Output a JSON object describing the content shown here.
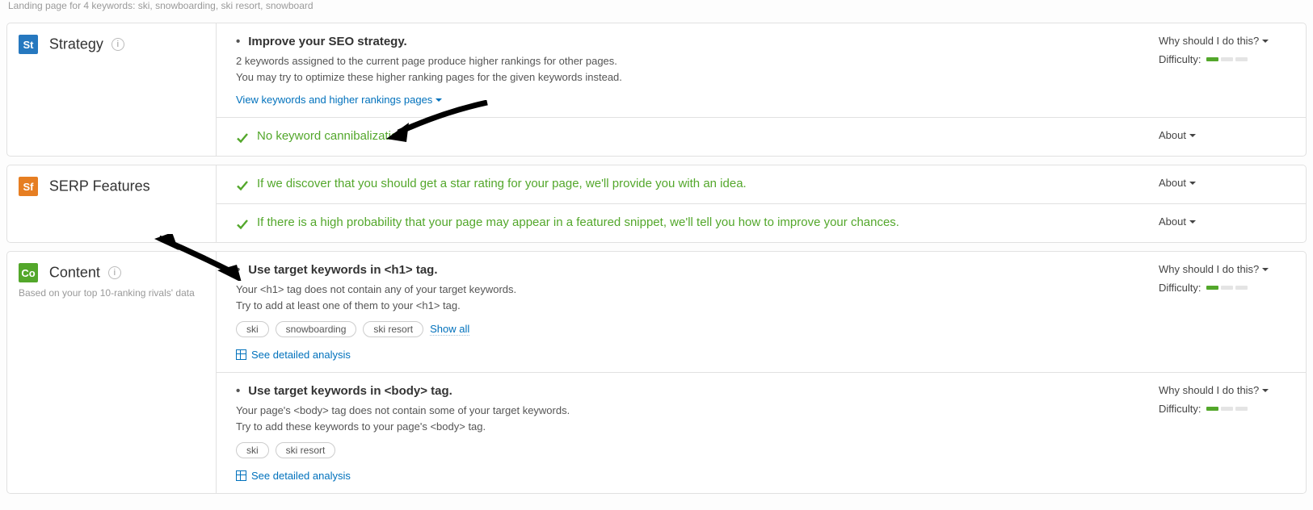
{
  "crumb": "Landing page for 4 keywords: ski, snowboarding, ski resort, snowboard",
  "labels": {
    "why": "Why should I do this?",
    "about": "About",
    "difficulty": "Difficulty:",
    "show_all": "Show all",
    "see_detailed": "See detailed analysis"
  },
  "sections": {
    "strategy": {
      "badge": "St",
      "title": "Strategy",
      "improve": {
        "title": "Improve your SEO strategy.",
        "line1": "2 keywords assigned to the current page produce higher rankings for other pages.",
        "line2": "You may try to optimize these higher ranking pages for the given keywords instead.",
        "link": "View keywords and higher rankings pages",
        "difficulty": 1
      },
      "noCannibal": "No keyword cannibalization"
    },
    "serp": {
      "badge": "Sf",
      "title": "SERP Features",
      "star": "If we discover that you should get a star rating for your page, we'll provide you with an idea.",
      "snippet": "If there is a high probability that your page may appear in a featured snippet, we'll tell you how to improve your chances."
    },
    "content": {
      "badge": "Co",
      "title": "Content",
      "sub": "Based on your top 10-ranking rivals' data",
      "h1": {
        "title": "Use target keywords in <h1> tag.",
        "line1": "Your <h1> tag does not contain any of your target keywords.",
        "line2": "Try to add at least one of them to your <h1> tag.",
        "chips": [
          "ski",
          "snowboarding",
          "ski resort"
        ],
        "difficulty": 1
      },
      "body": {
        "title": "Use target keywords in <body> tag.",
        "line1": "Your page's <body> tag does not contain some of your target keywords.",
        "line2": "Try to add these keywords to your page's <body> tag.",
        "chips": [
          "ski",
          "ski resort"
        ],
        "difficulty": 1
      }
    }
  }
}
